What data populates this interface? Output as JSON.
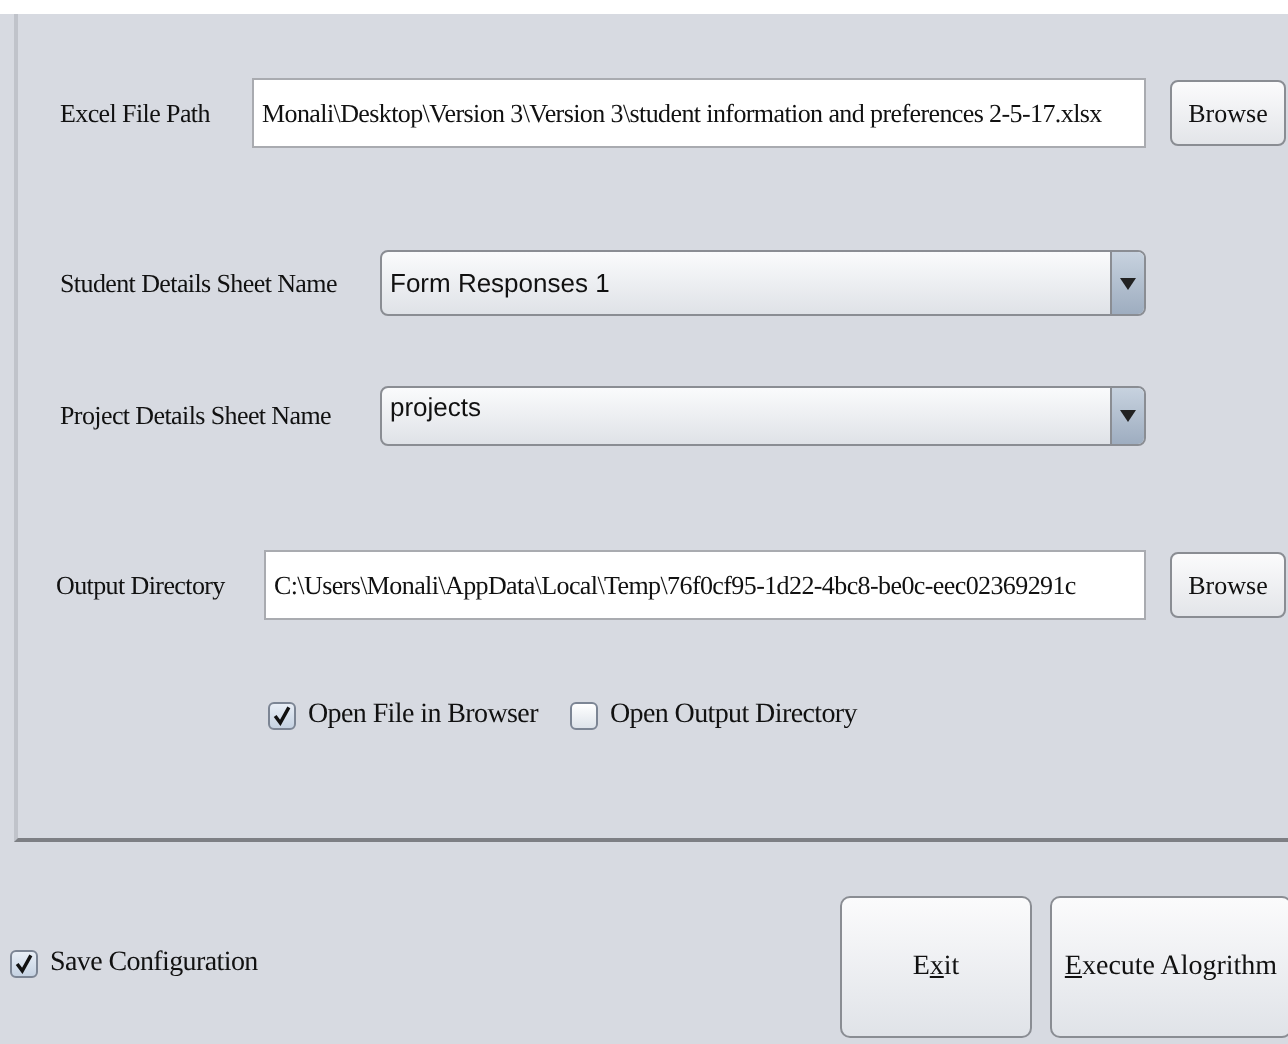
{
  "form": {
    "rows": [
      {
        "kind": "file",
        "label": "Excel File Path",
        "value": "Monali\\Desktop\\Version 3\\Version 3\\student information and preferences 2-5-17.xlsx",
        "button": "Browse"
      },
      {
        "kind": "combo",
        "label": "Student Details Sheet Name",
        "value": "Form Responses 1"
      },
      {
        "kind": "combo",
        "label": "Project Details Sheet Name",
        "value": "projects"
      },
      {
        "kind": "file",
        "label": "Output Directory",
        "value": "C:\\Users\\Monali\\AppData\\Local\\Temp\\76f0cf95-1d22-4bc8-be0c-eec02369291c",
        "button": "Browse"
      }
    ],
    "options": [
      {
        "label": "Open File in Browser",
        "checked": true
      },
      {
        "label": "Open Output Directory",
        "checked": false
      }
    ]
  },
  "footer": {
    "save_configuration": {
      "label": "Save Configuration",
      "checked": true
    },
    "buttons": [
      {
        "before": "E",
        "mnemonic": "x",
        "after": "it"
      },
      {
        "mnemonic": "E",
        "after": "xecute Alogrithm"
      }
    ]
  }
}
